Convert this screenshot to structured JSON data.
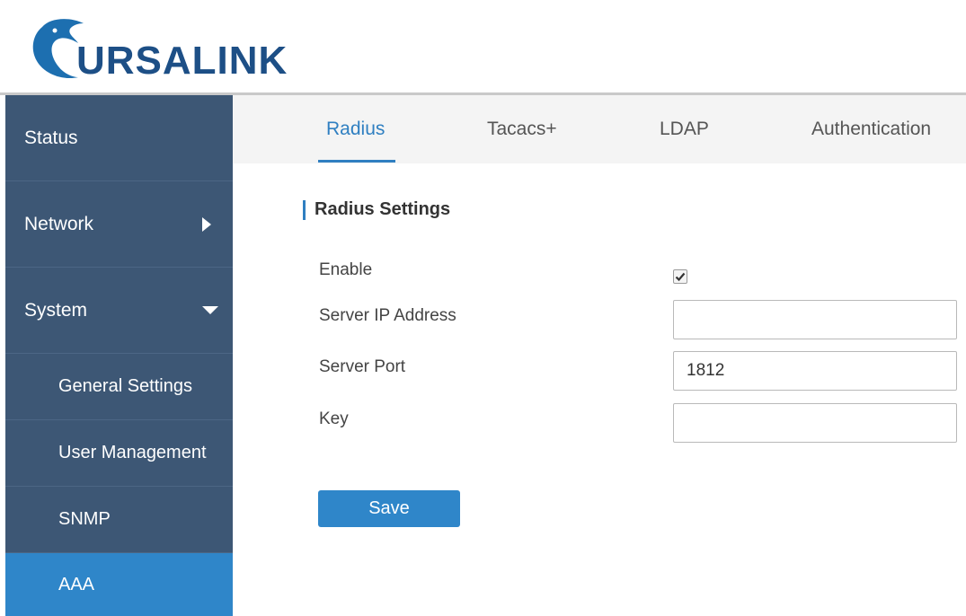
{
  "brand": {
    "name": "URSALINK",
    "logo_icon": "ursalink-bear-icon",
    "color": "#1d4f86"
  },
  "sidebar": {
    "items": [
      {
        "label": "Status"
      },
      {
        "label": "Network",
        "icon": "chevron-right-icon"
      },
      {
        "label": "System",
        "icon": "chevron-down-icon"
      }
    ],
    "sub_items": [
      {
        "label": "General Settings"
      },
      {
        "label": "User Management"
      },
      {
        "label": "SNMP"
      },
      {
        "label": "AAA",
        "active": true
      }
    ]
  },
  "tabs": [
    {
      "label": "Radius",
      "active": true
    },
    {
      "label": "Tacacs+"
    },
    {
      "label": "LDAP"
    },
    {
      "label": "Authentication"
    }
  ],
  "form": {
    "title": "Radius Settings",
    "enable_label": "Enable",
    "enable_checked": true,
    "server_ip_label": "Server IP Address",
    "server_ip_value": "",
    "server_port_label": "Server Port",
    "server_port_value": "1812",
    "key_label": "Key",
    "key_value": "",
    "save_label": "Save"
  },
  "colors": {
    "sidebar_bg": "#3d5775",
    "accent": "#2f86c9",
    "tab_active": "#2f7fc1"
  }
}
